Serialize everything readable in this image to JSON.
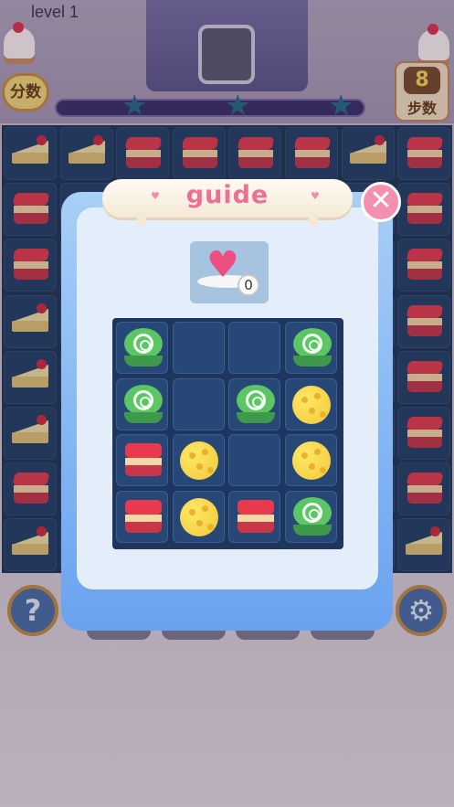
{
  "header": {
    "level_label": "level 1",
    "score_label": "分数",
    "moves_value": "8",
    "moves_label": "步数",
    "progress_stars": 3
  },
  "board": {
    "rows": [
      [
        "cake",
        "cake",
        "sandwich",
        "sandwich",
        "sandwich",
        "sandwich",
        "cake",
        "sandwich"
      ],
      [
        "sandwich",
        "",
        "",
        "",
        "",
        "",
        "",
        "sandwich"
      ],
      [
        "sandwich",
        "",
        "",
        "",
        "",
        "",
        "",
        "sandwich"
      ],
      [
        "cake",
        "",
        "",
        "",
        "",
        "",
        "",
        "sandwich"
      ],
      [
        "cake",
        "",
        "",
        "",
        "",
        "",
        "",
        "sandwich"
      ],
      [
        "cake",
        "",
        "",
        "",
        "",
        "",
        "",
        "sandwich"
      ],
      [
        "sandwich",
        "",
        "",
        "",
        "",
        "",
        "",
        "sandwich"
      ],
      [
        "cake",
        "",
        "",
        "",
        "",
        "",
        "",
        "cake"
      ]
    ]
  },
  "bottom": {
    "help_icon": "question-icon",
    "help_label": "?",
    "settings_icon": "gear-icon",
    "tool_slots": 4
  },
  "dialog": {
    "title": "guide",
    "close_icon": "close-icon",
    "close_label": "✕",
    "target": {
      "icon": "heart-cookie-icon",
      "count": "0"
    },
    "grid": [
      [
        "macaron",
        "empty",
        "empty",
        "macaron"
      ],
      [
        "macaron",
        "empty",
        "macaron",
        "cheese"
      ],
      [
        "sandwich",
        "cheese",
        "empty",
        "cheese"
      ],
      [
        "sandwich",
        "cheese",
        "sandwich",
        "macaron"
      ]
    ]
  },
  "colors": {
    "accent_pink": "#ee6f96",
    "board_blue": "#1f3557",
    "dialog_blue": "#6aa2f0"
  }
}
